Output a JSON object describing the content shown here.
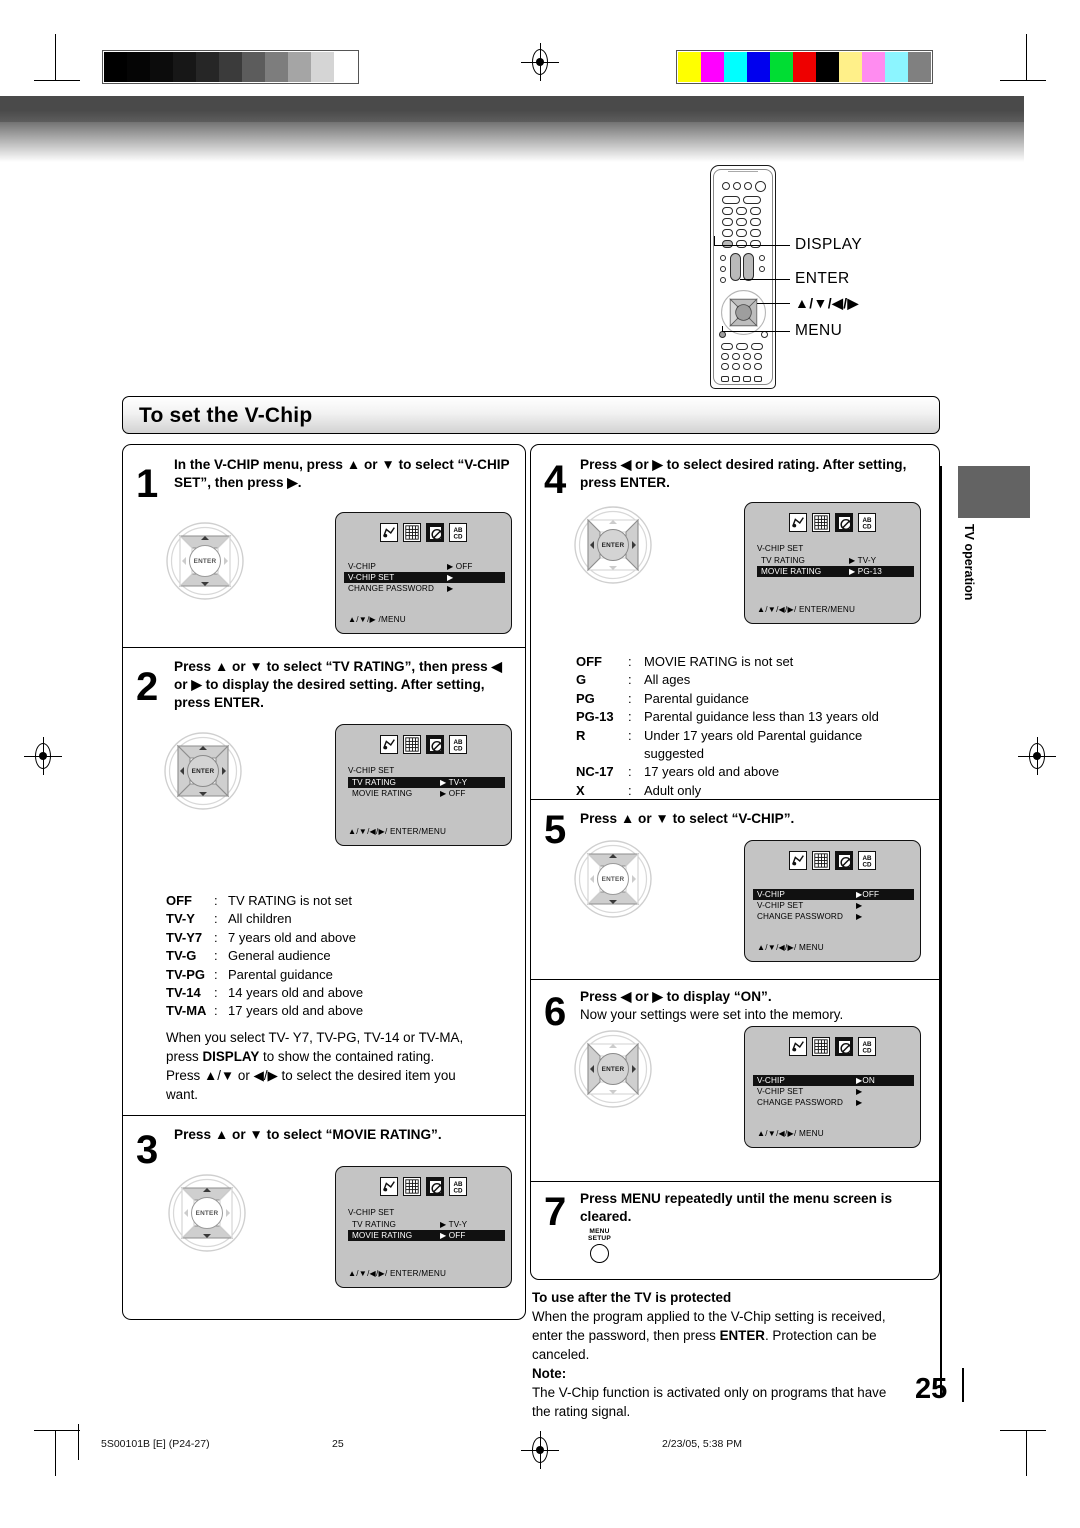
{
  "page": {
    "title": "To set the V-Chip",
    "number": "25",
    "side_tab": "TV operation"
  },
  "remote": {
    "callouts": [
      {
        "label": "DISPLAY"
      },
      {
        "label": "ENTER"
      },
      {
        "label": "▲/▼/◀/▶"
      },
      {
        "label": "MENU"
      }
    ],
    "enter_label": "ENTER"
  },
  "steps": [
    {
      "num": "1",
      "text": "In the V-CHIP menu, press ▲ or ▼ to select “V-CHIP SET”, then press ▶.",
      "osd": {
        "header": "",
        "rows": [
          {
            "key": "V-CHIP",
            "value": "▶ OFF",
            "highlight": false
          },
          {
            "key": "V-CHIP SET",
            "value": "▶",
            "highlight": true
          },
          {
            "key": "CHANGE PASSWORD",
            "value": "▶",
            "highlight": false
          }
        ],
        "footer": "▲/▼/▶ /MENU"
      }
    },
    {
      "num": "2",
      "text": "Press ▲ or ▼ to select “TV RATING”, then press ◀ or ▶ to display the desired setting. After setting, press ENTER.",
      "osd": {
        "header": "V-CHIP SET",
        "rows": [
          {
            "key": "TV RATING",
            "value": "▶ TV-Y",
            "highlight": true
          },
          {
            "key": "MOVIE RATING",
            "value": "▶ OFF",
            "highlight": false
          }
        ],
        "footer": "▲/▼/◀/▶/ ENTER/MENU"
      }
    },
    {
      "num": "3",
      "text": "Press ▲ or ▼ to select “MOVIE RATING”.",
      "osd": {
        "header": "V-CHIP SET",
        "rows": [
          {
            "key": "TV RATING",
            "value": "▶ TV-Y",
            "highlight": false
          },
          {
            "key": "MOVIE RATING",
            "value": "▶ OFF",
            "highlight": true
          }
        ],
        "footer": "▲/▼/◀/▶/ ENTER/MENU"
      }
    },
    {
      "num": "4",
      "text": "Press ◀ or ▶ to select desired rating. After setting, press ENTER.",
      "osd": {
        "header": "V-CHIP SET",
        "rows": [
          {
            "key": "TV RATING",
            "value": "▶ TV-Y",
            "highlight": false
          },
          {
            "key": "MOVIE RATING",
            "value": "▶ PG-13",
            "highlight": true
          }
        ],
        "footer": "▲/▼/◀/▶/ ENTER/MENU"
      }
    },
    {
      "num": "5",
      "text": "Press ▲ or ▼ to select “V-CHIP”.",
      "osd": {
        "header": "",
        "rows": [
          {
            "key": "V-CHIP",
            "value": "▶OFF",
            "highlight": true
          },
          {
            "key": "V-CHIP SET",
            "value": "▶",
            "highlight": false
          },
          {
            "key": "CHANGE PASSWORD",
            "value": "▶",
            "highlight": false
          }
        ],
        "footer": "▲/▼/◀/▶/ MENU"
      }
    },
    {
      "num": "6",
      "text_bold": "Press ◀ or ▶ to display “ON”.",
      "text_normal": "Now your settings were set into the memory.",
      "osd": {
        "header": "",
        "rows": [
          {
            "key": "V-CHIP",
            "value": "▶ON",
            "highlight": true
          },
          {
            "key": "V-CHIP SET",
            "value": "▶",
            "highlight": false
          },
          {
            "key": "CHANGE PASSWORD",
            "value": "▶",
            "highlight": false
          }
        ],
        "footer": "▲/▼/◀/▶/ MENU"
      }
    },
    {
      "num": "7",
      "text": "Press MENU repeatedly until the menu screen is cleared.",
      "button": {
        "line1": "MENU",
        "line2": "SETUP"
      }
    }
  ],
  "tv_ratings": [
    {
      "code": "OFF",
      "desc": "TV RATING is not set"
    },
    {
      "code": "TV-Y",
      "desc": "All children"
    },
    {
      "code": "TV-Y7",
      "desc": "7 years old and above"
    },
    {
      "code": "TV-G",
      "desc": "General audience"
    },
    {
      "code": "TV-PG",
      "desc": "Parental guidance"
    },
    {
      "code": "TV-14",
      "desc": "14 years old and above"
    },
    {
      "code": "TV-MA",
      "desc": "17 years old and above"
    }
  ],
  "tv_ratings_note": {
    "l1a": "When you select TV- Y7, TV-PG, TV-14 or TV-MA,",
    "l2a": "press ",
    "l2b": "DISPLAY",
    "l2c": " to show the contained rating.",
    "l3": "Press ▲/▼ or ◀/▶ to select the desired item you",
    "l4": "want."
  },
  "movie_ratings": [
    {
      "code": "OFF",
      "desc": "MOVIE RATING is not set"
    },
    {
      "code": "G",
      "desc": "All ages"
    },
    {
      "code": "PG",
      "desc": "Parental guidance"
    },
    {
      "code": "PG-13",
      "desc": "Parental guidance less than 13 years old"
    },
    {
      "code": "R",
      "desc": "Under 17 years old Parental guidance"
    },
    {
      "code": "",
      "desc": "suggested"
    },
    {
      "code": "NC-17",
      "desc": "17 years old and above"
    },
    {
      "code": "X",
      "desc": "Adult only"
    }
  ],
  "protected_note": {
    "heading": "To use after the TV is protected",
    "l1": "When the program applied to the V-Chip setting is received,",
    "l2a": "enter the password, then press ",
    "l2b": "ENTER",
    "l2c": ". Protection can be",
    "l3": "canceled.",
    "note_heading": "Note:",
    "l4": "The V-Chip function is activated only on programs that have",
    "l5": "the rating signal."
  },
  "print_footer": {
    "job": "5S00101B [E] (P24-27)",
    "page": "25",
    "timestamp": "2/23/05, 5:38 PM"
  },
  "colors": {
    "grayscale_bars": [
      "#000000",
      "#050505",
      "#0c0c0c",
      "#171717",
      "#262626",
      "#3b3b3b",
      "#5c5c5c",
      "#7d7d7d",
      "#a5a5a5",
      "#d5d5d5",
      "#ffffff"
    ],
    "color_bars": [
      "#ffff00",
      "#ff00ff",
      "#00ffff",
      "#0000ee",
      "#00dd33",
      "#ee0000",
      "#000000",
      "#fff089",
      "#ff8cf0",
      "#8cf5ff",
      "#808080"
    ],
    "highlight": "#111111",
    "osd_background": "#c4c4c4",
    "side_tab": "#636363"
  }
}
